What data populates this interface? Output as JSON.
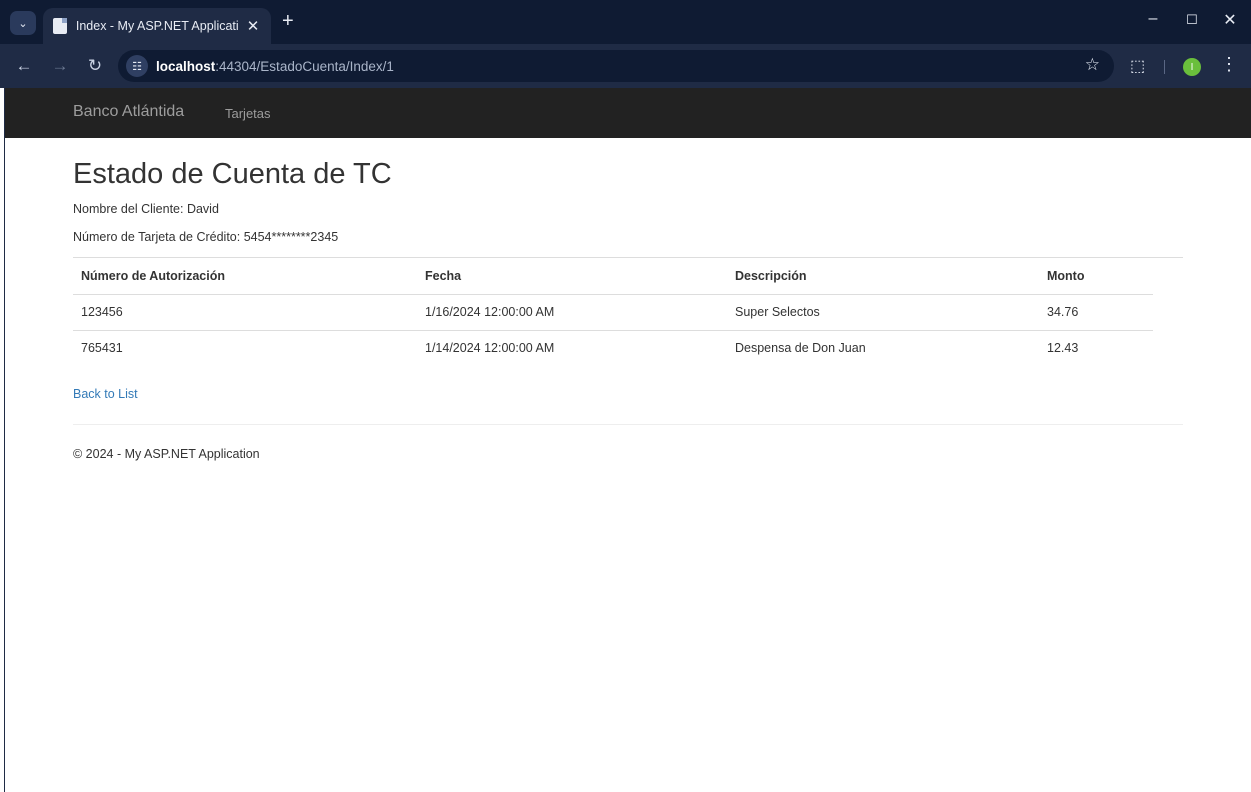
{
  "browser": {
    "tab_title": "Index - My ASP.NET Application",
    "url_host": "localhost",
    "url_path": ":44304/EstadoCuenta/Index/1",
    "profile_initial": "I"
  },
  "site": {
    "brand": "Banco Atlántida",
    "nav_items": [
      "Tarjetas"
    ]
  },
  "page": {
    "title": "Estado de Cuenta de TC",
    "client_line": "Nombre del Cliente: David",
    "card_line": "Número de Tarjeta de Crédito: 5454********2345",
    "table": {
      "headers": [
        "Número de Autorización",
        "Fecha",
        "Descripción",
        "Monto"
      ],
      "rows": [
        [
          "123456",
          "1/16/2024 12:00:00 AM",
          "Super Selectos",
          "34.76"
        ],
        [
          "765431",
          "1/14/2024 12:00:00 AM",
          "Despensa de Don Juan",
          "12.43"
        ]
      ]
    },
    "back_link": "Back to List",
    "footer": "© 2024 - My ASP.NET Application"
  },
  "colors": {
    "navbar_bg": "#222222",
    "link": "#337ab7",
    "chrome_dark": "#0f1b33",
    "chrome_mid": "#1f2b45"
  }
}
